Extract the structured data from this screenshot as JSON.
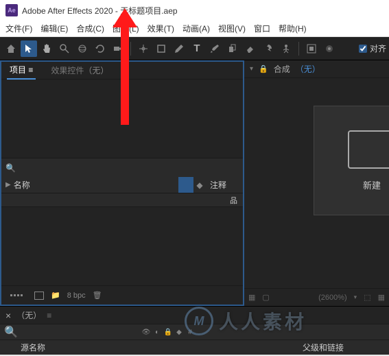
{
  "titlebar": {
    "app_icon_text": "Ae",
    "title": "Adobe After Effects 2020 - 无标题项目.aep"
  },
  "menubar": {
    "file": "文件(F)",
    "edit": "编辑(E)",
    "comp": "合成(C)",
    "layer": "图层(L)",
    "effect": "效果(T)",
    "anim": "动画(A)",
    "view": "视图(V)",
    "window": "窗口",
    "help": "帮助(H)"
  },
  "toolbar": {
    "snapping_label": "对齐"
  },
  "project_panel": {
    "tabs": {
      "project": "项目",
      "effect_controls_prefix": "效果控件",
      "effect_controls_none": "（无）"
    },
    "columns": {
      "name": "名称",
      "comment": "注释"
    },
    "footer": {
      "bpc": "8 bpc"
    }
  },
  "comp_viewer": {
    "lock_icon_name": "lock-icon",
    "label_prefix": "合成",
    "label_none": "（无）",
    "new_comp_label": "新建",
    "zoom": "(2600%)"
  },
  "timeline": {
    "tab_none": "（无）",
    "columns": {
      "source_name": "源名称",
      "parent_link": "父级和链接"
    }
  },
  "watermark": {
    "logo": "M",
    "text": "人人素材"
  }
}
